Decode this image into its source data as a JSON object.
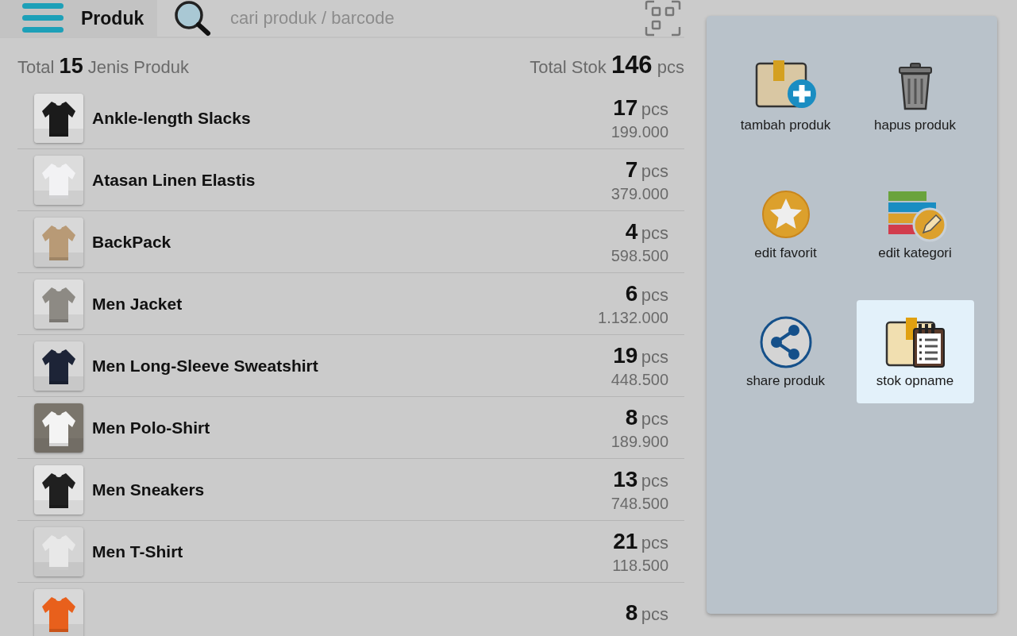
{
  "header": {
    "title": "Produk",
    "search": {
      "placeholder": "cari produk / barcode"
    }
  },
  "summary": {
    "left_prefix": "Total",
    "product_count": "15",
    "left_suffix": "Jenis Produk",
    "right_prefix": "Total Stok",
    "stock_total": "146",
    "right_unit": "pcs"
  },
  "products": [
    {
      "name": "Ankle-length Slacks",
      "quantity": "17",
      "unit": "pcs",
      "price": "199.000"
    },
    {
      "name": "Atasan Linen Elastis",
      "quantity": "7",
      "unit": "pcs",
      "price": "379.000"
    },
    {
      "name": "BackPack",
      "quantity": "4",
      "unit": "pcs",
      "price": "598.500"
    },
    {
      "name": "Men Jacket",
      "quantity": "6",
      "unit": "pcs",
      "price": "1.132.000"
    },
    {
      "name": "Men Long-Sleeve Sweatshirt",
      "quantity": "19",
      "unit": "pcs",
      "price": "448.500"
    },
    {
      "name": "Men Polo-Shirt",
      "quantity": "8",
      "unit": "pcs",
      "price": "189.900"
    },
    {
      "name": "Men Sneakers",
      "quantity": "13",
      "unit": "pcs",
      "price": "748.500"
    },
    {
      "name": "Men T-Shirt",
      "quantity": "21",
      "unit": "pcs",
      "price": "118.500"
    },
    {
      "quantity": "8",
      "unit": "pcs"
    }
  ],
  "actions": [
    {
      "kind": "add",
      "label": "tambah produk",
      "selected": false
    },
    {
      "kind": "delete",
      "label": "hapus produk",
      "selected": false
    },
    {
      "kind": "favorite",
      "label": "edit favorit",
      "selected": false
    },
    {
      "kind": "category",
      "label": "edit kategori",
      "selected": false
    },
    {
      "kind": "share",
      "label": "share produk",
      "selected": false
    },
    {
      "kind": "opname",
      "label": "stok opname",
      "selected": true
    }
  ]
}
